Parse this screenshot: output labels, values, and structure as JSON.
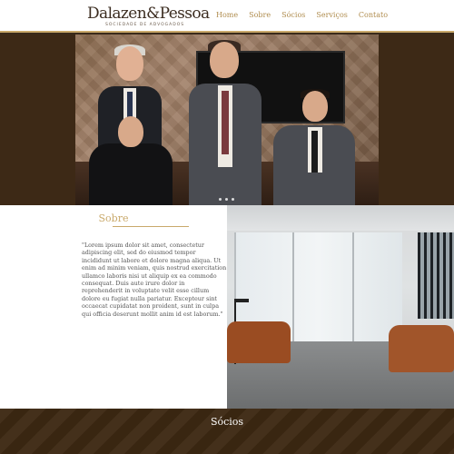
{
  "header": {
    "logo_name": "Dalazen&Pessoa",
    "logo_subtitle": "SOCIEDADE DE ADVOGADOS",
    "nav": [
      "Home",
      "Sobre",
      "Sócios",
      "Serviços",
      "Contato"
    ]
  },
  "hero": {
    "slide_count": 3
  },
  "sobre": {
    "title": "Sobre",
    "text": "\"Lorem ipsum dolor sit amet, consectetur adipiscing elit, sed do eiusmod tempor incididunt ut labore et dolore magna aliqua. Ut enim ad minim veniam, quis nostrud exercitation ullamco laboris nisi ut aliquip ex ea commodo consequat. Duis aute irure dolor in reprehenderit in voluptate velit esse cillum dolore eu fugiat nulla pariatur. Excepteur sint occaecat cupidatat non proident, sunt in culpa qui officia deserunt mollit anim id est laborum.\""
  },
  "socios": {
    "title": "Sócios"
  },
  "colors": {
    "accent": "#c9a96b",
    "dark_brown": "#3c2812",
    "nav_text": "#b08d4f"
  }
}
